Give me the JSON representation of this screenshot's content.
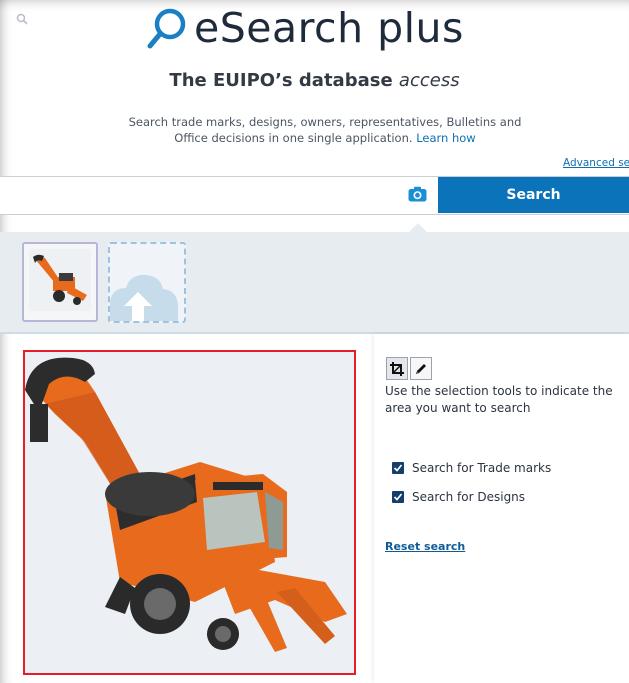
{
  "header": {
    "logo_text": "eSearch plus",
    "tagline_main": "The EUIPO’s database ",
    "tagline_italic": "access",
    "description": "Search trade marks, designs, owners, representatives, Bulletins and Office decisions in one single application.",
    "learn_how": "Learn how",
    "advanced_search": "Advanced sear"
  },
  "search": {
    "placeholder": "",
    "button_label": "Search"
  },
  "tools": {
    "help_text": "Use the selection tools to indicate the area you want to search"
  },
  "options": {
    "trade_marks_label": "Search for Trade marks",
    "trade_marks_checked": true,
    "designs_label": "Search for Designs",
    "designs_checked": true
  },
  "reset_label": "Reset search",
  "colors": {
    "accent": "#0b73b9",
    "selection_border": "#e41e26",
    "machine": "#e86a1c"
  },
  "icons": [
    "search-icon",
    "camera-icon",
    "crop-icon",
    "pencil-icon",
    "cloud-upload-icon",
    "checkbox-checked-icon"
  ]
}
